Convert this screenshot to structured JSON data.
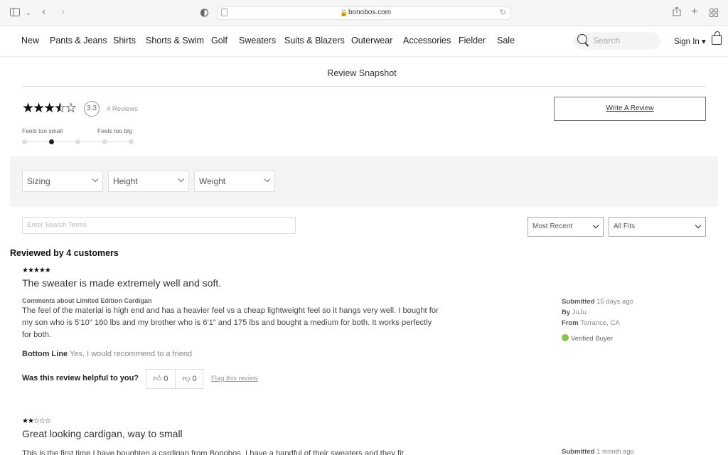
{
  "browser": {
    "url": "bonobos.com",
    "icons": [
      "sidebar-icon",
      "chevron-down-icon",
      "back-icon",
      "forward-icon",
      "privacy-shield-icon",
      "reader-icon",
      "lock-icon",
      "reload-icon",
      "share-icon",
      "new-tab-icon",
      "tab-overview-icon"
    ]
  },
  "nav": {
    "items": [
      "New",
      "Pants & Jeans",
      "Shirts",
      "Shorts & Swim",
      "Golf",
      "Sweaters",
      "Suits & Blazers",
      "Outerwear",
      "Accessories",
      "Fielder",
      "Sale"
    ],
    "search_placeholder": "Search",
    "sign_in": "Sign In ▾"
  },
  "snapshot": {
    "title": "Review Snapshot",
    "rating": 3.3,
    "rating_label": "3.3",
    "stars_filled": 3,
    "stars_half": 1,
    "stars_total": 5,
    "review_count": "4 Reviews",
    "fit_small_label": "Feels too small",
    "fit_big_label": "Feels too big",
    "fit_positions": 5,
    "fit_selected_index": 1,
    "write_review": "Write A Review"
  },
  "filters": {
    "sizing": "Sizing",
    "height": "Height",
    "weight": "Weight",
    "search_placeholder": "Enter Search Terms",
    "sort": "Most Recent",
    "fit": "All Fits"
  },
  "reviews": {
    "heading": "Reviewed by 4 customers",
    "items": [
      {
        "stars": "★★★★★",
        "rating": 5,
        "title": "The sweater is made extremely well and soft.",
        "comments_about": "Comments about Limited Edition Cardigan",
        "body": "The feel of the material is high end and has a heavier feel vs a cheap lightweight feel so it hangs very well. I bought for my son who is 5'10\" 160 lbs and my brother who is 6'1\" and 175 lbs and bought a medium for both. It works perfectly for both.",
        "bottom_line_label": "Bottom Line",
        "bottom_line": "Yes, I would recommend to a friend",
        "helpful_question": "Was this review helpful to you?",
        "helpful_yes": "0",
        "helpful_no": "0",
        "flag": "Flag this review",
        "submitted_label": "Submitted",
        "submitted": "15 days ago",
        "by_label": "By",
        "by": "JuJu",
        "from_label": "From",
        "from": "Torrance, CA",
        "verified": "Verified Buyer"
      },
      {
        "stars": "★★☆☆☆",
        "rating": 2,
        "title": "Great looking cardigan, way to small",
        "body": "This is the first time I have boughten a cardigan from Bonobos. I have a handful of their sweaters and they fit",
        "submitted_label": "Submitted",
        "submitted": "1 month ago"
      }
    ]
  },
  "colors": {
    "verified_green": "#8bc34a",
    "filter_band": "#f4f4f4"
  }
}
